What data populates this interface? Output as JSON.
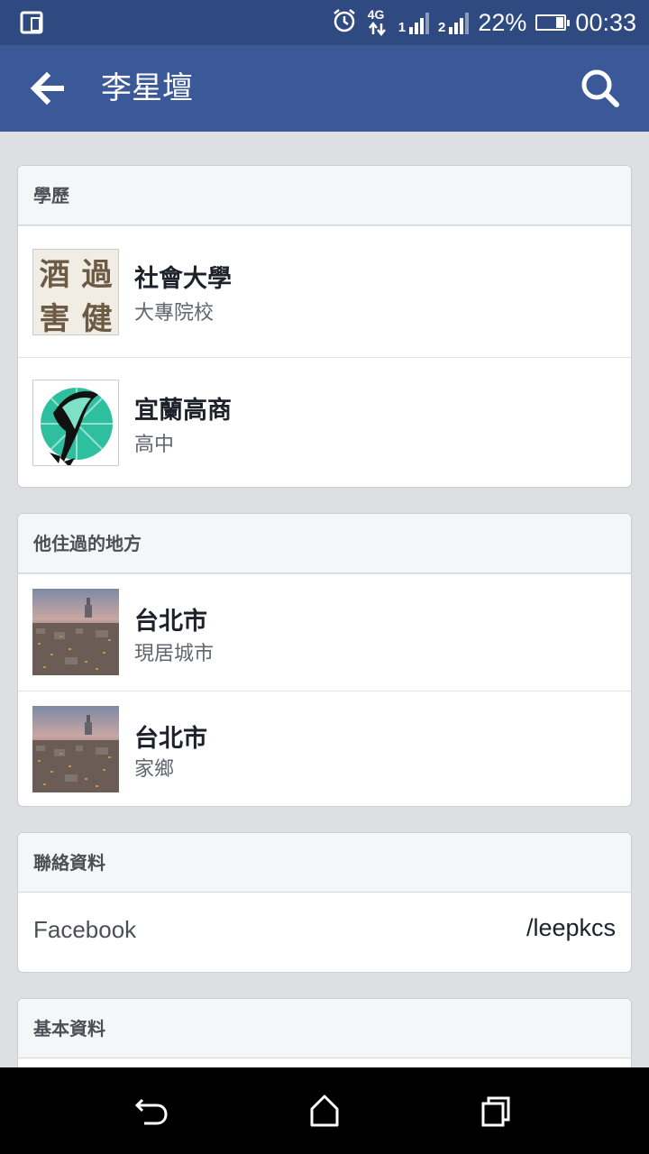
{
  "status_bar": {
    "network": "4G",
    "sim1": "1",
    "sim2": "2",
    "battery": "22%",
    "time": "00:33",
    "icons": [
      "screen-rotate-icon",
      "alarm-icon",
      "data-arrows-icon",
      "signal-icon",
      "battery-icon"
    ]
  },
  "app_bar": {
    "title": "李星壇",
    "back_icon": "back-arrow-icon",
    "search_icon": "search-icon"
  },
  "education": {
    "header": "學歷",
    "items": [
      {
        "name": "社會大學",
        "type": "大專院校",
        "logo_text": [
          "酒",
          "過",
          "害",
          "健"
        ]
      },
      {
        "name": "宜蘭高商",
        "type": "高中",
        "logo": "whale-logo"
      }
    ]
  },
  "places": {
    "header": "他住過的地方",
    "items": [
      {
        "name": "台北市",
        "type": "現居城市",
        "photo": "taipei-skyline"
      },
      {
        "name": "台北市",
        "type": "家鄉",
        "photo": "taipei-skyline"
      }
    ]
  },
  "contact": {
    "header": "聯絡資料",
    "items": [
      {
        "label": "Facebook",
        "value": "/leepkcs"
      }
    ]
  },
  "basic": {
    "header": "基本資料"
  },
  "nav_bar": {
    "icons": [
      "nav-back-icon",
      "nav-home-icon",
      "nav-recents-icon"
    ]
  },
  "colors": {
    "status_bar": "#2f4a80",
    "app_bar": "#3b5998",
    "background": "#dddfe2",
    "card_header": "#f5f6f7",
    "whale_circle": "#2ebf9f"
  }
}
